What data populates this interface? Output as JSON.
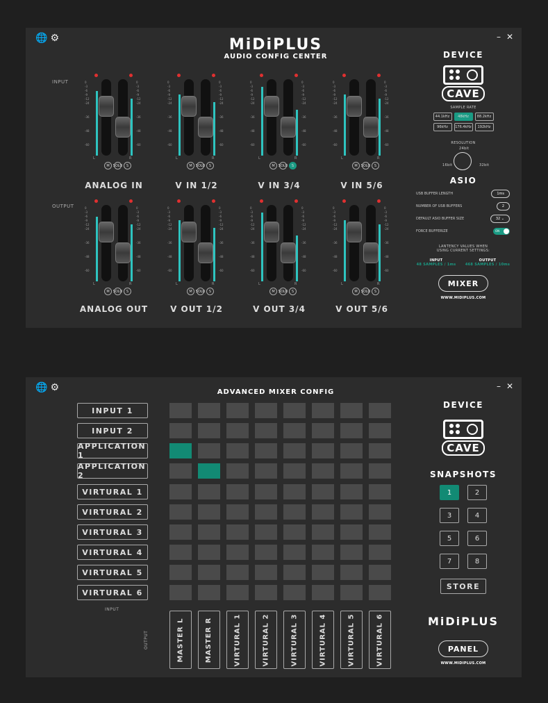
{
  "panel1": {
    "brand": "MiDiPLUS",
    "subtitle": "AUDIO CONFIG CENTER",
    "row_input": "INPUT",
    "row_output": "OUTPUT",
    "channels_in": [
      "ANALOG IN",
      "V IN 1/2",
      "V IN 3/4",
      "V IN 5/6"
    ],
    "channels_out": [
      "ANALOG OUT",
      "V OUT 1/2",
      "V OUT 3/4",
      "V OUT 5/6"
    ],
    "msolo": [
      "M",
      "SOLO",
      "S"
    ],
    "lr": [
      "L",
      "R"
    ],
    "scale": [
      "0",
      "-3",
      "-6",
      "-9",
      "-12",
      "-24",
      "-36",
      "-48",
      "-60"
    ],
    "device_title": "DEVICE",
    "device_brand": "CAVE",
    "sample_rate_label": "SAMPLE RATE",
    "sample_rates": [
      "44.1kHz",
      "48kHz",
      "88.2kHz",
      "96kHz",
      "176.4kHz",
      "192kHz"
    ],
    "sample_rate_selected": 1,
    "resolution_label": "RESOLUTION",
    "resolution_options": [
      "16bit",
      "24bit",
      "32bit"
    ],
    "asio_title": "ASIO",
    "usb_buffer_length_label": "USB BUFFER LENGTH",
    "usb_buffer_length_value": "1ms",
    "num_usb_buffers_label": "NUMBER OF USB BUFFERS",
    "num_usb_buffers_value": "2",
    "default_asio_buffer_label": "DEFAULT ASIO BUFFER SIZE",
    "default_asio_buffer_value": "32",
    "force_bufferize_label": "FORCE BUFFERIZE",
    "force_bufferize_value": "ON",
    "latency_note_1": "LANTENCY VALUES WHEN",
    "latency_note_2": "USING CURRENT SETTINGS:",
    "latency_input_label": "INPUT",
    "latency_input_value": "48 SAMPLES / 1ms",
    "latency_output_label": "OUTPUT",
    "latency_output_value": "468 SAMPLES / 10ms",
    "mixer_button": "MIXER",
    "website": "WWW.MIDIPLUS.COM"
  },
  "panel2": {
    "title": "ADVANCED MIXER CONFIG",
    "inputs": [
      "INPUT 1",
      "INPUT 2",
      "APPLICATION 1",
      "APPLICATION 2",
      "VIRTURAL 1",
      "VIRTURAL 2",
      "VIRTURAL 3",
      "VIRTURAL 4",
      "VIRTURAL 5",
      "VIRTURAL 6"
    ],
    "outputs": [
      "MASTER L",
      "MASTER R",
      "VIRTURAL 1",
      "VIRTURAL 2",
      "VIRTURAL 3",
      "VIRTURAL 4",
      "VIRTURAL 5",
      "VIRTURAL 6"
    ],
    "active_cells": [
      [
        2,
        0
      ],
      [
        3,
        1
      ]
    ],
    "axis_input": "INPUT",
    "axis_output": "OUTPUT",
    "device_title": "DEVICE",
    "device_brand": "CAVE",
    "snapshots_title": "SNAPSHOTS",
    "snapshots": [
      "1",
      "2",
      "3",
      "4",
      "5",
      "6",
      "7",
      "8"
    ],
    "snapshot_selected": 0,
    "store_button": "STORE",
    "brand": "MiDiPLUS",
    "panel_button": "PANEL",
    "website": "WWW.MIDIPLUS.COM"
  },
  "colors": {
    "accent": "#1a9b84",
    "meter": "#2ec4c0",
    "led": "#e03030",
    "panel": "#2c2c2c",
    "bg": "#1f1f1f"
  },
  "icons": [
    "globe-icon",
    "gear-icon",
    "minimize-icon",
    "close-icon"
  ]
}
